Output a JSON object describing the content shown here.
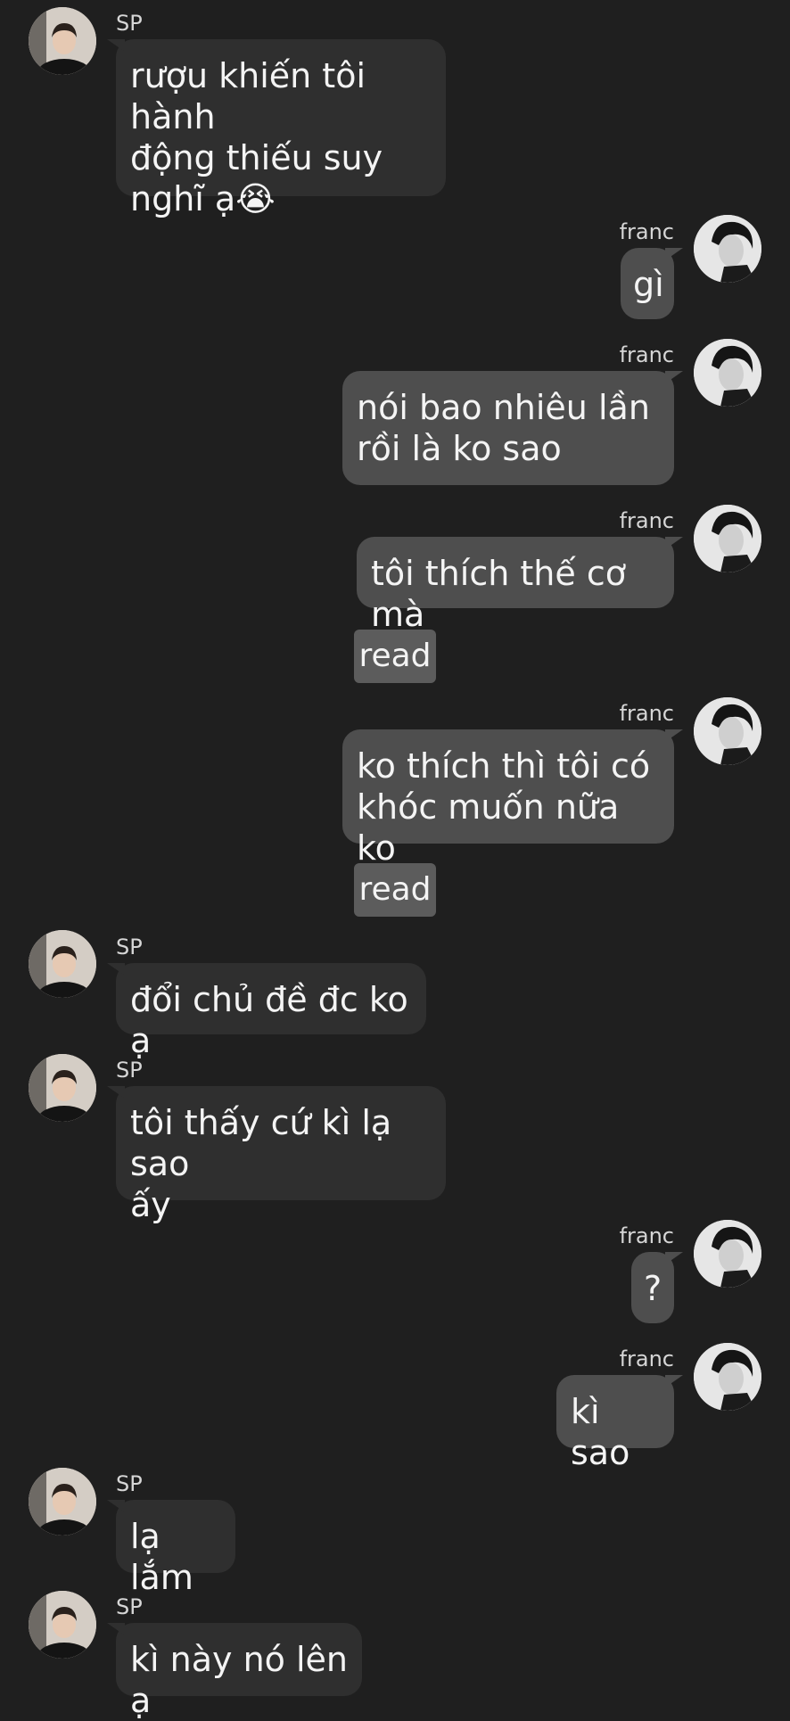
{
  "participants": {
    "incoming_name": "SP",
    "outgoing_name": "franc"
  },
  "messages": [
    {
      "sender": "SP",
      "text": "rượu khiến tôi hành\nđộng thiếu suy\nnghĩ ạ😭"
    },
    {
      "sender": "franc",
      "text": "gì"
    },
    {
      "sender": "franc",
      "text": "nói bao nhiêu lần\nrồi là ko sao"
    },
    {
      "sender": "franc",
      "text": "tôi thích thế cơ mà"
    },
    {
      "sender": "franc",
      "text": "ko thích thì tôi có\nkhóc muốn nữa ko"
    },
    {
      "sender": "SP",
      "text": "đổi chủ đề đc ko ạ"
    },
    {
      "sender": "SP",
      "text": "tôi thấy cứ kì lạ sao\nấy"
    },
    {
      "sender": "franc",
      "text": "?"
    },
    {
      "sender": "franc",
      "text": "kì sao"
    },
    {
      "sender": "SP",
      "text": "lạ lắm"
    },
    {
      "sender": "SP",
      "text": "kì này nó lên ạ"
    }
  ],
  "read_receipts": [
    "read",
    "read"
  ],
  "colors": {
    "background": "#1f1f1f",
    "incoming_bubble": "#2f2f2f",
    "outgoing_bubble": "#4e4e4e",
    "read_badge": "#5c5c5c"
  },
  "icons": {
    "incoming_avatar": "user-avatar-sp",
    "outgoing_avatar": "user-avatar-franc"
  }
}
